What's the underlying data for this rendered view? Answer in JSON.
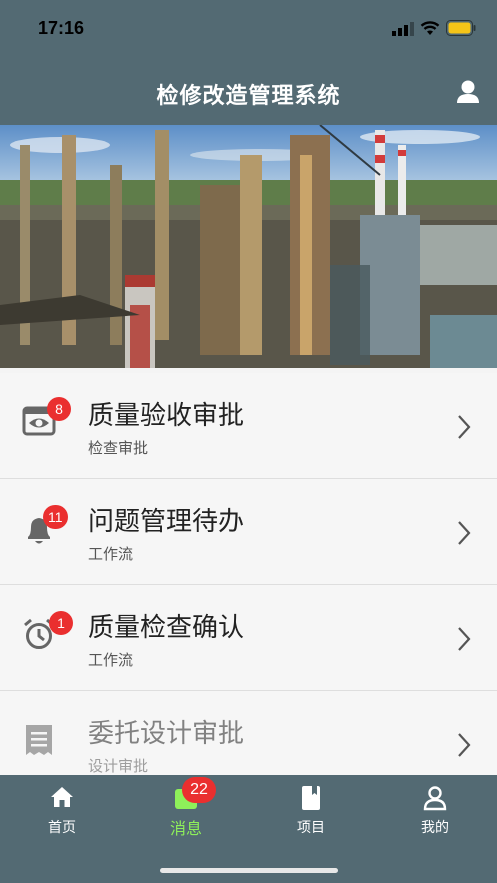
{
  "status": {
    "time": "17:16"
  },
  "header": {
    "title": "检修改造管理系统",
    "profile_icon": "user-icon"
  },
  "list": [
    {
      "title": "质量验收审批",
      "subtitle": "检查审批",
      "badge": "8",
      "icon": "eye-tray-icon"
    },
    {
      "title": "问题管理待办",
      "subtitle": "工作流",
      "badge": "11",
      "icon": "bell-icon"
    },
    {
      "title": "质量检查确认",
      "subtitle": "工作流",
      "badge": "1",
      "icon": "alarm-clock-icon"
    },
    {
      "title": "委托设计审批",
      "subtitle": "设计审批",
      "badge": "",
      "icon": "receipt-icon"
    }
  ],
  "tabs": [
    {
      "label": "首页",
      "icon": "home-icon"
    },
    {
      "label": "消息",
      "icon": "message-icon",
      "badge": "22",
      "active": true
    },
    {
      "label": "项目",
      "icon": "book-icon"
    },
    {
      "label": "我的",
      "icon": "person-icon"
    }
  ],
  "colors": {
    "header": "#536a73",
    "badge": "#ea2f2f",
    "active_tab": "#8ef05a"
  }
}
